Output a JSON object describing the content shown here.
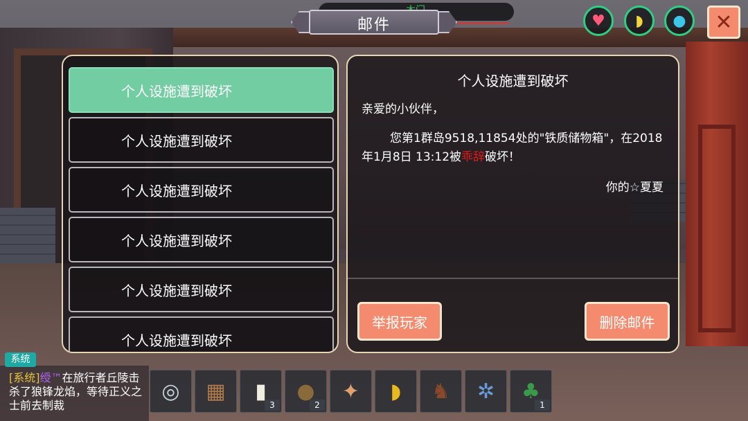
{
  "header": {
    "title": "邮件",
    "location": "木门"
  },
  "status_icons": [
    {
      "name": "heart-icon",
      "glyph": "♥",
      "color": "#ff5a7a"
    },
    {
      "name": "stamina-icon",
      "glyph": "◗",
      "color": "#f2d63a"
    },
    {
      "name": "water-drop-icon",
      "glyph": "●",
      "color": "#3ec6e8"
    }
  ],
  "close_label": "✕",
  "mail_list": [
    "个人设施遭到破坏",
    "个人设施遭到破坏",
    "个人设施遭到破坏",
    "个人设施遭到破坏",
    "个人设施遭到破坏",
    "个人设施遭到破坏"
  ],
  "mail_detail": {
    "title": "个人设施遭到破坏",
    "greeting": "亲爱的小伙伴，",
    "body_prefix": "您第1群岛9518,11854处的\"铁质储物箱\"，在2018年1月8日 13:12被",
    "attacker": "乖辞",
    "body_suffix": "破坏！",
    "signature": "你的☆夏夏",
    "report_button": "举报玩家",
    "delete_button": "删除邮件"
  },
  "chat": {
    "tag": "系统",
    "system_label": "[系统]",
    "player_name": "绶™",
    "message": "在旅行者丘陵击杀了狼锋龙焰，等待正义之士前去制裁"
  },
  "hotbar": [
    {
      "name": "disc-item",
      "glyph": "◎",
      "color": "#c8d4de",
      "count": ""
    },
    {
      "name": "box-item",
      "glyph": "▦",
      "color": "#b07a4a",
      "count": ""
    },
    {
      "name": "milk-bottle-item",
      "glyph": "▮",
      "color": "#f0ece0",
      "count": "3"
    },
    {
      "name": "seed-bag-item",
      "glyph": "●",
      "color": "#8a6a3a",
      "count": "2"
    },
    {
      "name": "fish-bone-item",
      "glyph": "✦",
      "color": "#e0a070",
      "count": ""
    },
    {
      "name": "banana-item",
      "glyph": "◗",
      "color": "#e8b820",
      "count": ""
    },
    {
      "name": "horse-item",
      "glyph": "♞",
      "color": "#8a4a2a",
      "count": ""
    },
    {
      "name": "wand-item",
      "glyph": "✲",
      "color": "#6a9ad8",
      "count": ""
    },
    {
      "name": "herb-item",
      "glyph": "♣",
      "color": "#3a9a4a",
      "count": "1"
    }
  ]
}
